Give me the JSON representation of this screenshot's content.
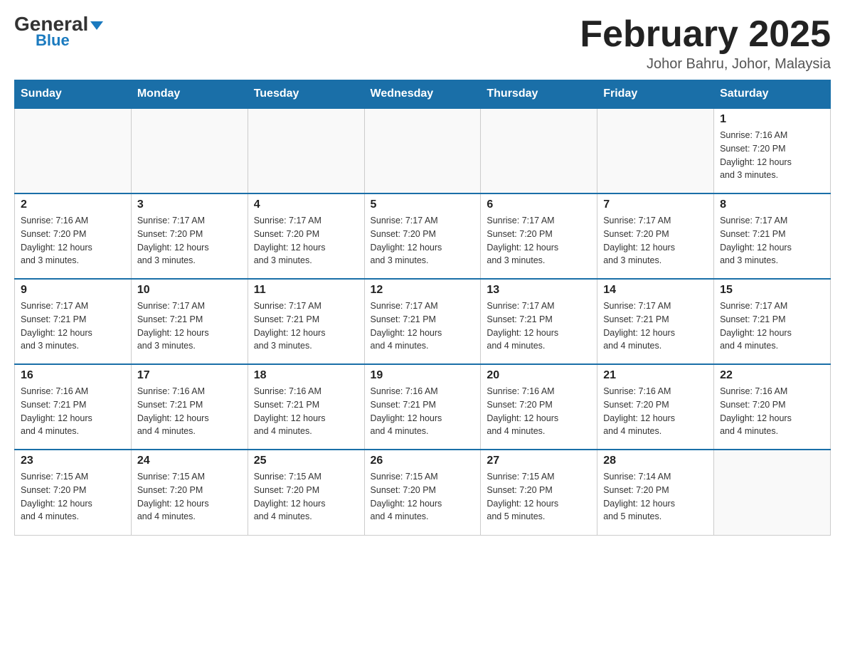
{
  "header": {
    "logo_general": "General",
    "logo_blue": "Blue",
    "month_title": "February 2025",
    "location": "Johor Bahru, Johor, Malaysia"
  },
  "days_of_week": [
    "Sunday",
    "Monday",
    "Tuesday",
    "Wednesday",
    "Thursday",
    "Friday",
    "Saturday"
  ],
  "weeks": [
    [
      {
        "day": "",
        "info": ""
      },
      {
        "day": "",
        "info": ""
      },
      {
        "day": "",
        "info": ""
      },
      {
        "day": "",
        "info": ""
      },
      {
        "day": "",
        "info": ""
      },
      {
        "day": "",
        "info": ""
      },
      {
        "day": "1",
        "info": "Sunrise: 7:16 AM\nSunset: 7:20 PM\nDaylight: 12 hours\nand 3 minutes."
      }
    ],
    [
      {
        "day": "2",
        "info": "Sunrise: 7:16 AM\nSunset: 7:20 PM\nDaylight: 12 hours\nand 3 minutes."
      },
      {
        "day": "3",
        "info": "Sunrise: 7:17 AM\nSunset: 7:20 PM\nDaylight: 12 hours\nand 3 minutes."
      },
      {
        "day": "4",
        "info": "Sunrise: 7:17 AM\nSunset: 7:20 PM\nDaylight: 12 hours\nand 3 minutes."
      },
      {
        "day": "5",
        "info": "Sunrise: 7:17 AM\nSunset: 7:20 PM\nDaylight: 12 hours\nand 3 minutes."
      },
      {
        "day": "6",
        "info": "Sunrise: 7:17 AM\nSunset: 7:20 PM\nDaylight: 12 hours\nand 3 minutes."
      },
      {
        "day": "7",
        "info": "Sunrise: 7:17 AM\nSunset: 7:20 PM\nDaylight: 12 hours\nand 3 minutes."
      },
      {
        "day": "8",
        "info": "Sunrise: 7:17 AM\nSunset: 7:21 PM\nDaylight: 12 hours\nand 3 minutes."
      }
    ],
    [
      {
        "day": "9",
        "info": "Sunrise: 7:17 AM\nSunset: 7:21 PM\nDaylight: 12 hours\nand 3 minutes."
      },
      {
        "day": "10",
        "info": "Sunrise: 7:17 AM\nSunset: 7:21 PM\nDaylight: 12 hours\nand 3 minutes."
      },
      {
        "day": "11",
        "info": "Sunrise: 7:17 AM\nSunset: 7:21 PM\nDaylight: 12 hours\nand 3 minutes."
      },
      {
        "day": "12",
        "info": "Sunrise: 7:17 AM\nSunset: 7:21 PM\nDaylight: 12 hours\nand 4 minutes."
      },
      {
        "day": "13",
        "info": "Sunrise: 7:17 AM\nSunset: 7:21 PM\nDaylight: 12 hours\nand 4 minutes."
      },
      {
        "day": "14",
        "info": "Sunrise: 7:17 AM\nSunset: 7:21 PM\nDaylight: 12 hours\nand 4 minutes."
      },
      {
        "day": "15",
        "info": "Sunrise: 7:17 AM\nSunset: 7:21 PM\nDaylight: 12 hours\nand 4 minutes."
      }
    ],
    [
      {
        "day": "16",
        "info": "Sunrise: 7:16 AM\nSunset: 7:21 PM\nDaylight: 12 hours\nand 4 minutes."
      },
      {
        "day": "17",
        "info": "Sunrise: 7:16 AM\nSunset: 7:21 PM\nDaylight: 12 hours\nand 4 minutes."
      },
      {
        "day": "18",
        "info": "Sunrise: 7:16 AM\nSunset: 7:21 PM\nDaylight: 12 hours\nand 4 minutes."
      },
      {
        "day": "19",
        "info": "Sunrise: 7:16 AM\nSunset: 7:21 PM\nDaylight: 12 hours\nand 4 minutes."
      },
      {
        "day": "20",
        "info": "Sunrise: 7:16 AM\nSunset: 7:20 PM\nDaylight: 12 hours\nand 4 minutes."
      },
      {
        "day": "21",
        "info": "Sunrise: 7:16 AM\nSunset: 7:20 PM\nDaylight: 12 hours\nand 4 minutes."
      },
      {
        "day": "22",
        "info": "Sunrise: 7:16 AM\nSunset: 7:20 PM\nDaylight: 12 hours\nand 4 minutes."
      }
    ],
    [
      {
        "day": "23",
        "info": "Sunrise: 7:15 AM\nSunset: 7:20 PM\nDaylight: 12 hours\nand 4 minutes."
      },
      {
        "day": "24",
        "info": "Sunrise: 7:15 AM\nSunset: 7:20 PM\nDaylight: 12 hours\nand 4 minutes."
      },
      {
        "day": "25",
        "info": "Sunrise: 7:15 AM\nSunset: 7:20 PM\nDaylight: 12 hours\nand 4 minutes."
      },
      {
        "day": "26",
        "info": "Sunrise: 7:15 AM\nSunset: 7:20 PM\nDaylight: 12 hours\nand 4 minutes."
      },
      {
        "day": "27",
        "info": "Sunrise: 7:15 AM\nSunset: 7:20 PM\nDaylight: 12 hours\nand 5 minutes."
      },
      {
        "day": "28",
        "info": "Sunrise: 7:14 AM\nSunset: 7:20 PM\nDaylight: 12 hours\nand 5 minutes."
      },
      {
        "day": "",
        "info": ""
      }
    ]
  ]
}
